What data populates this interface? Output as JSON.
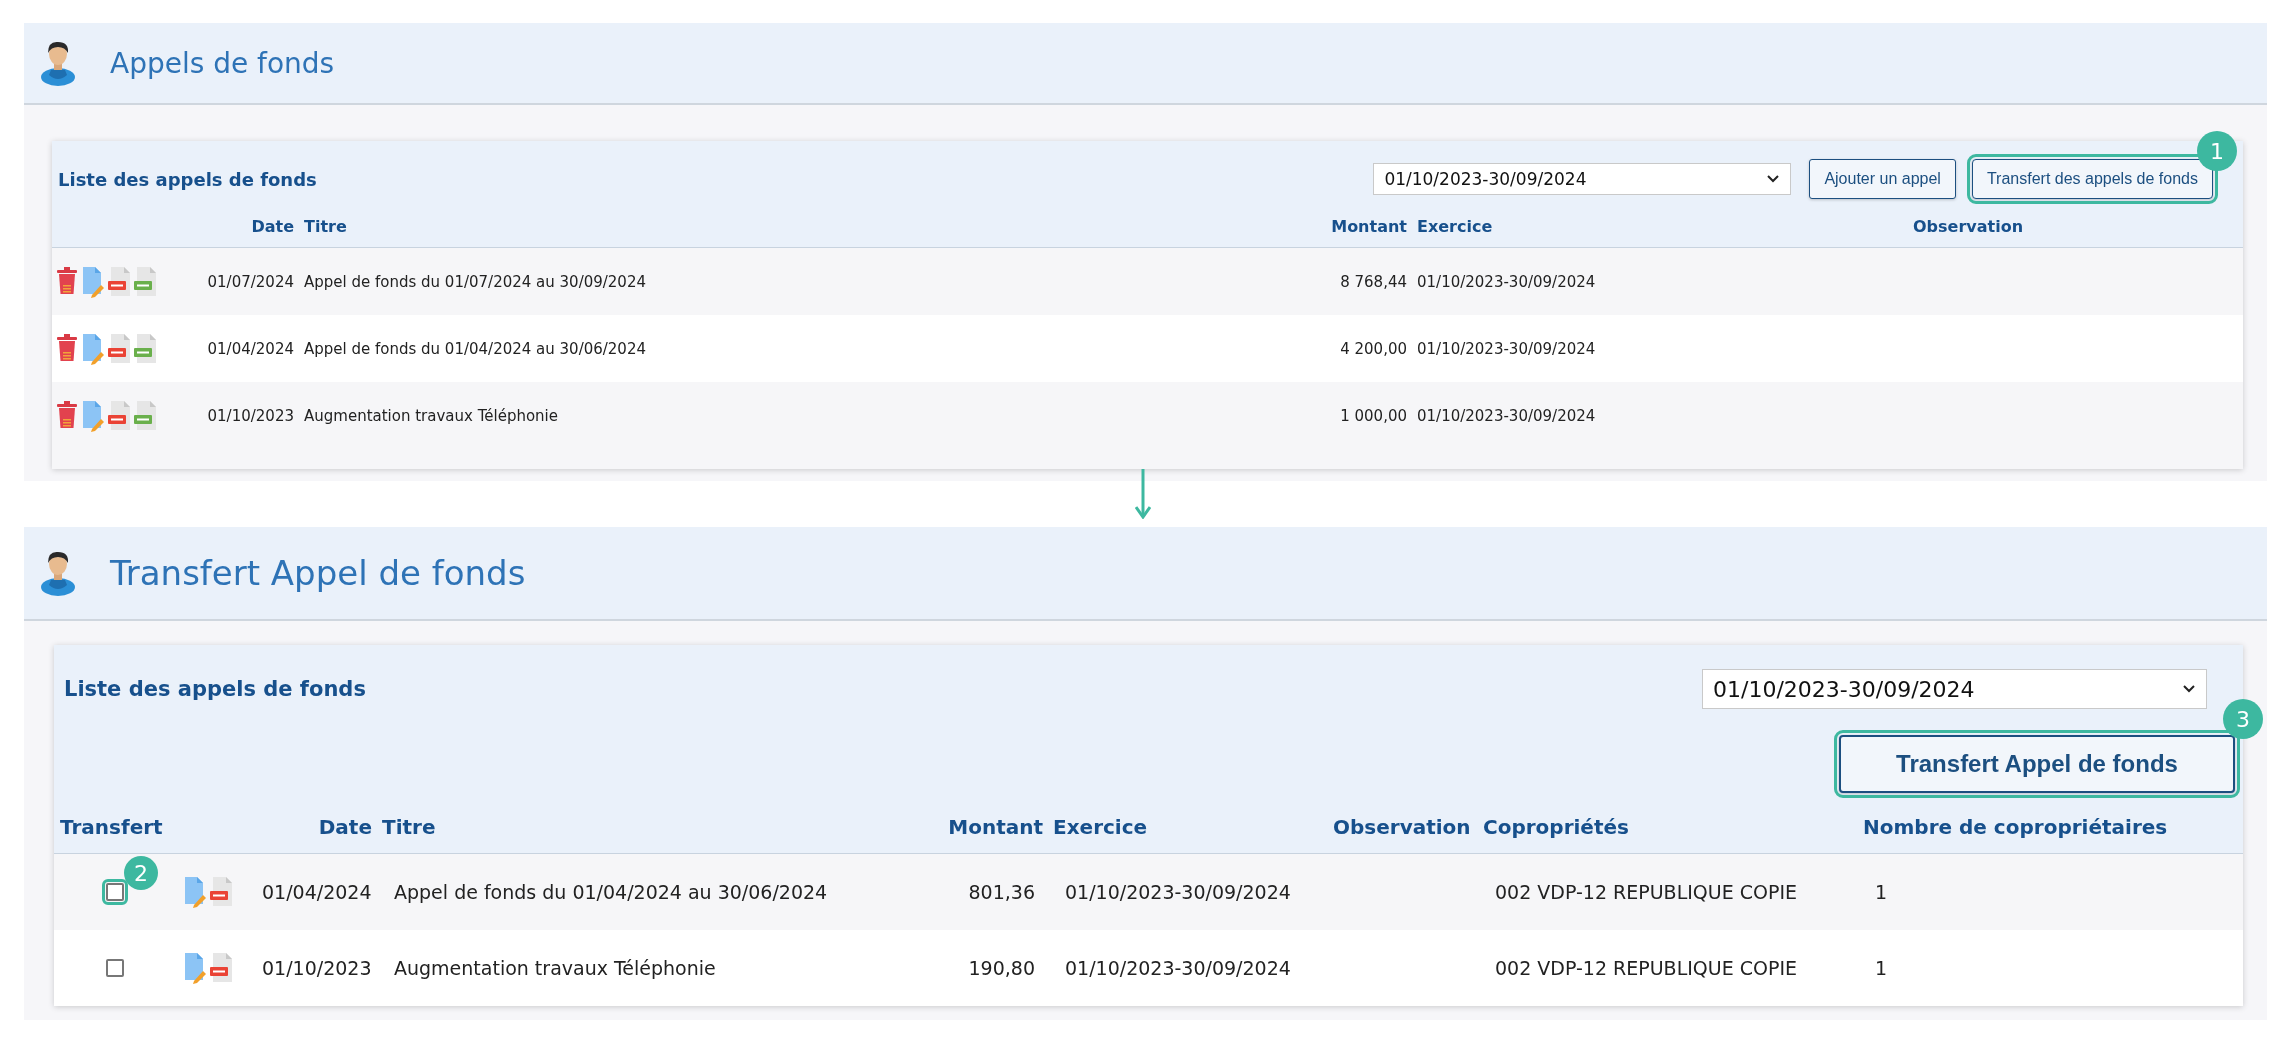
{
  "panels": [
    {
      "kind": "list",
      "title": "Appels de fonds",
      "card": {
        "heading": "Liste des appels de fonds",
        "period": {
          "value": "01/10/2023-30/09/2024"
        },
        "buttons": [
          {
            "label": "Ajouter un appel"
          },
          {
            "label": "Transfert des appels de fonds",
            "callout": "1"
          }
        ],
        "columns": [
          "Date",
          "Titre",
          "Montant",
          "Exercice",
          "Observation"
        ],
        "rows": [
          {
            "date": "01/07/2024",
            "title": "Appel de fonds du 01/07/2024 au 30/09/2024",
            "amount": "8 768,44",
            "fiscal_year": "01/10/2023-30/09/2024"
          },
          {
            "date": "01/04/2024",
            "title": "Appel de fonds du 01/04/2024 au 30/06/2024",
            "amount": "4 200,00",
            "fiscal_year": "01/10/2023-30/09/2024"
          },
          {
            "date": "01/10/2023",
            "title": "Augmentation travaux Téléphonie",
            "amount": "1 000,00",
            "fiscal_year": "01/10/2023-30/09/2024"
          }
        ]
      }
    },
    {
      "kind": "transfer",
      "title": "Transfert Appel de fonds",
      "card": {
        "heading": "Liste des appels de fonds",
        "period": {
          "value": "01/10/2023-30/09/2024"
        },
        "buttons": [
          {
            "label": "Transfert Appel de fonds",
            "callout": "3"
          }
        ],
        "columns": [
          "Transfert",
          "Date",
          "Titre",
          "Montant",
          "Exercice",
          "Observation",
          "Copropriétés",
          "Nombre de copropriétaires"
        ],
        "rows": [
          {
            "checked": false,
            "callout": "2",
            "date": "01/04/2024",
            "title": "Appel de fonds du 01/04/2024 au 30/06/2024",
            "amount": "801,36",
            "fiscal_year": "01/10/2023-30/09/2024",
            "co_ownership": "002 VDP-12 REPUBLIQUE COPIE",
            "owner_count": "1"
          },
          {
            "checked": false,
            "date": "01/10/2023",
            "title": "Augmentation travaux Téléphonie",
            "amount": "190,80",
            "fiscal_year": "01/10/2023-30/09/2024",
            "co_ownership": "002 VDP-12 REPUBLIQUE COPIE",
            "owner_count": "1"
          }
        ]
      }
    }
  ]
}
